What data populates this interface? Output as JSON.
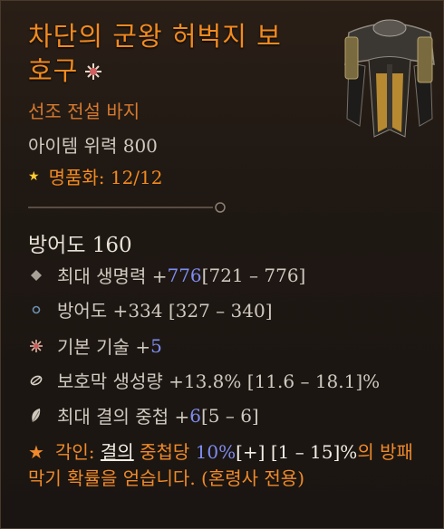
{
  "item": {
    "name": "차단의 군왕 허벅지 보호구",
    "name_line1": "차단의 군왕 허벅지 보",
    "name_line2": "호구",
    "type": "선조 전설 바지",
    "power": "아이템 위력 800",
    "mastery_label": "명품화: 12/12"
  },
  "armor": {
    "label": "방어도 160"
  },
  "affixes": [
    {
      "icon": "diamond-icon",
      "pre": "최대 생명력 +",
      "value": "776",
      "post": " [721 – 776]"
    },
    {
      "icon": "ring-icon",
      "pre": "방어도 +334 [327 – 340]",
      "value": "",
      "post": ""
    },
    {
      "icon": "star-burst-icon",
      "pre": "기본 기술 +",
      "value": "5",
      "post": ""
    },
    {
      "icon": "barrier-icon",
      "pre": "보호막 생성량 +13.8% [11.6 – 18.1]%",
      "value": "",
      "post": ""
    },
    {
      "icon": "feather-icon",
      "pre": "최대 결의 중첩 +",
      "value": "6",
      "post": " [5 – 6]"
    }
  ],
  "aspect": {
    "lead": "각인: ",
    "keyword": "결의",
    "mid": " 중첩당 ",
    "value": "10%",
    "range": "[+] [1 – 15]%",
    "tail": "의 방패막기 확률을 얻습니다. (혼령사 전용)"
  },
  "colors": {
    "legendary_orange": "#f28a1f",
    "augment_blue": "#7f8cf0",
    "star_yellow": "#ffcc33"
  }
}
